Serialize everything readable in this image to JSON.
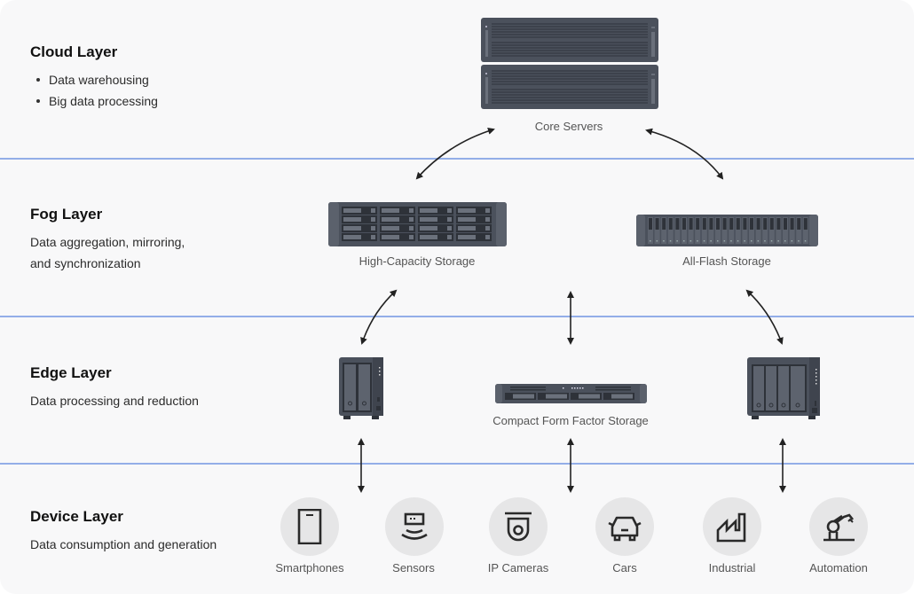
{
  "layers": [
    {
      "title": "Cloud Layer",
      "bullets": [
        "Data warehousing",
        "Big data processing"
      ]
    },
    {
      "title": "Fog Layer",
      "description_lines": [
        "Data aggregation, mirroring,",
        "and synchronization"
      ]
    },
    {
      "title": "Edge Layer",
      "description": "Data processing and reduction"
    },
    {
      "title": "Device Layer",
      "description": "Data consumption and generation"
    }
  ],
  "hardware": {
    "core_servers": {
      "label": "Core Servers",
      "icon": "rack-server-stack-icon"
    },
    "high_capacity": {
      "label": "High-Capacity Storage",
      "icon": "storage-array-16-bay-icon"
    },
    "all_flash": {
      "label": "All-Flash Storage",
      "icon": "flash-storage-24-bay-icon"
    },
    "edge_nas_2bay": {
      "label": "",
      "icon": "nas-2-bay-icon"
    },
    "compact": {
      "label": "Compact Form Factor Storage",
      "icon": "rack-storage-1u-icon"
    },
    "edge_nas_4bay": {
      "label": "",
      "icon": "nas-4-bay-icon"
    }
  },
  "devices": [
    {
      "label": "Smartphones",
      "icon": "smartphone-icon"
    },
    {
      "label": "Sensors",
      "icon": "sensor-icon"
    },
    {
      "label": "IP Cameras",
      "icon": "ip-camera-icon"
    },
    {
      "label": "Cars",
      "icon": "car-icon"
    },
    {
      "label": "Industrial",
      "icon": "factory-icon"
    },
    {
      "label": "Automation",
      "icon": "robot-arm-icon"
    }
  ],
  "colors": {
    "divider": "#93aee8",
    "hardware": "#4b515c",
    "device_circle": "#e6e6e7",
    "arrow": "#222222"
  }
}
